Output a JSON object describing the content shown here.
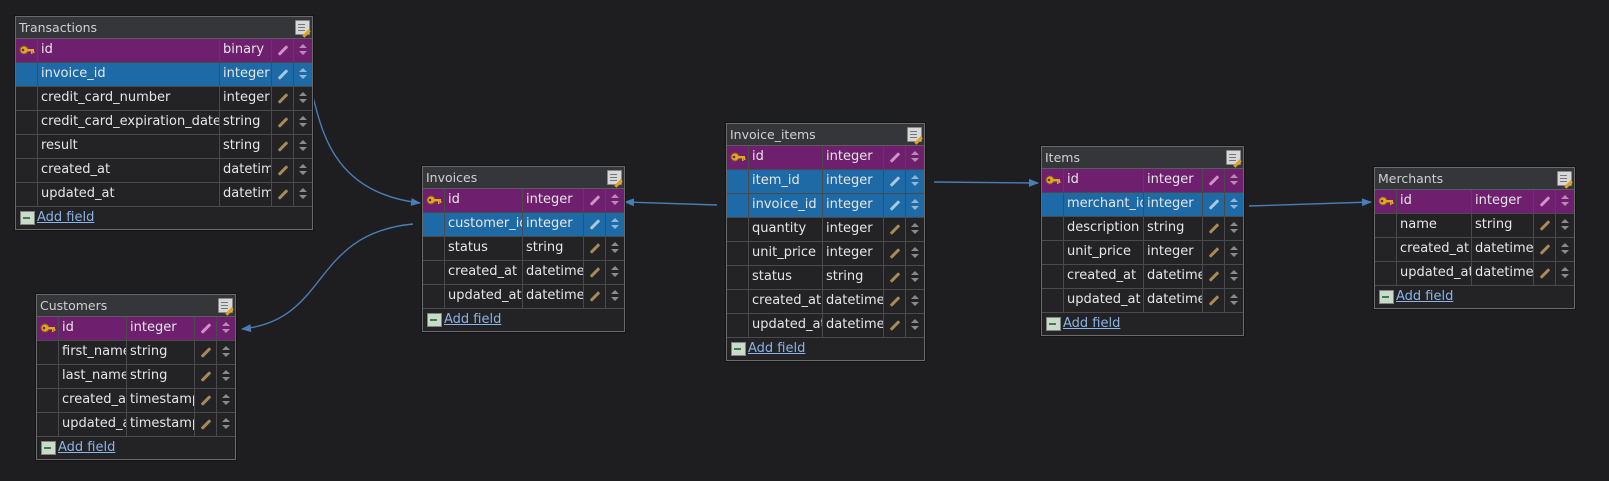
{
  "colors": {
    "background": "#1e1e20",
    "primary_key_row": "#6e1f6e",
    "foreign_key_row": "#1e6aa6",
    "relation_line": "#4a7db4",
    "key_icon": "#e0a820"
  },
  "add_field_label": "Add field",
  "tables": {
    "transactions": {
      "title": "Transactions",
      "fields": [
        {
          "name": "id",
          "type": "binary",
          "role": "pk"
        },
        {
          "name": "invoice_id",
          "type": "integer",
          "role": "fk"
        },
        {
          "name": "credit_card_number",
          "type": "integer",
          "role": ""
        },
        {
          "name": "credit_card_expiration_date",
          "type": "string",
          "role": ""
        },
        {
          "name": "result",
          "type": "string",
          "role": ""
        },
        {
          "name": "created_at",
          "type": "datetime",
          "role": ""
        },
        {
          "name": "updated_at",
          "type": "datetime",
          "role": ""
        }
      ]
    },
    "customers": {
      "title": "Customers",
      "fields": [
        {
          "name": "id",
          "type": "integer",
          "role": "pk"
        },
        {
          "name": "first_name",
          "type": "string",
          "role": ""
        },
        {
          "name": "last_name",
          "type": "string",
          "role": ""
        },
        {
          "name": "created_at",
          "type": "timestamp",
          "role": ""
        },
        {
          "name": "updated_at",
          "type": "timestamp",
          "role": ""
        }
      ]
    },
    "invoices": {
      "title": "Invoices",
      "fields": [
        {
          "name": "id",
          "type": "integer",
          "role": "pk"
        },
        {
          "name": "customer_id",
          "type": "integer",
          "role": "fk"
        },
        {
          "name": "status",
          "type": "string",
          "role": ""
        },
        {
          "name": "created_at",
          "type": "datetime",
          "role": ""
        },
        {
          "name": "updated_at",
          "type": "datetime",
          "role": ""
        }
      ]
    },
    "invoice_items": {
      "title": "Invoice_items",
      "fields": [
        {
          "name": "id",
          "type": "integer",
          "role": "pk"
        },
        {
          "name": "item_id",
          "type": "integer",
          "role": "fk"
        },
        {
          "name": "invoice_id",
          "type": "integer",
          "role": "fk"
        },
        {
          "name": "quantity",
          "type": "integer",
          "role": ""
        },
        {
          "name": "unit_price",
          "type": "integer",
          "role": ""
        },
        {
          "name": "status",
          "type": "string",
          "role": ""
        },
        {
          "name": "created_at",
          "type": "datetime",
          "role": ""
        },
        {
          "name": "updated_at",
          "type": "datetime",
          "role": ""
        }
      ]
    },
    "items": {
      "title": "Items",
      "fields": [
        {
          "name": "id",
          "type": "integer",
          "role": "pk"
        },
        {
          "name": "merchant_id",
          "type": "integer",
          "role": "fk"
        },
        {
          "name": "description",
          "type": "string",
          "role": ""
        },
        {
          "name": "unit_price",
          "type": "integer",
          "role": ""
        },
        {
          "name": "created_at",
          "type": "datetime",
          "role": ""
        },
        {
          "name": "updated_at",
          "type": "datetime",
          "role": ""
        }
      ]
    },
    "merchants": {
      "title": "Merchants",
      "fields": [
        {
          "name": "id",
          "type": "integer",
          "role": "pk"
        },
        {
          "name": "name",
          "type": "string",
          "role": ""
        },
        {
          "name": "created_at",
          "type": "datetime",
          "role": ""
        },
        {
          "name": "updated_at",
          "type": "datetime",
          "role": ""
        }
      ]
    }
  }
}
